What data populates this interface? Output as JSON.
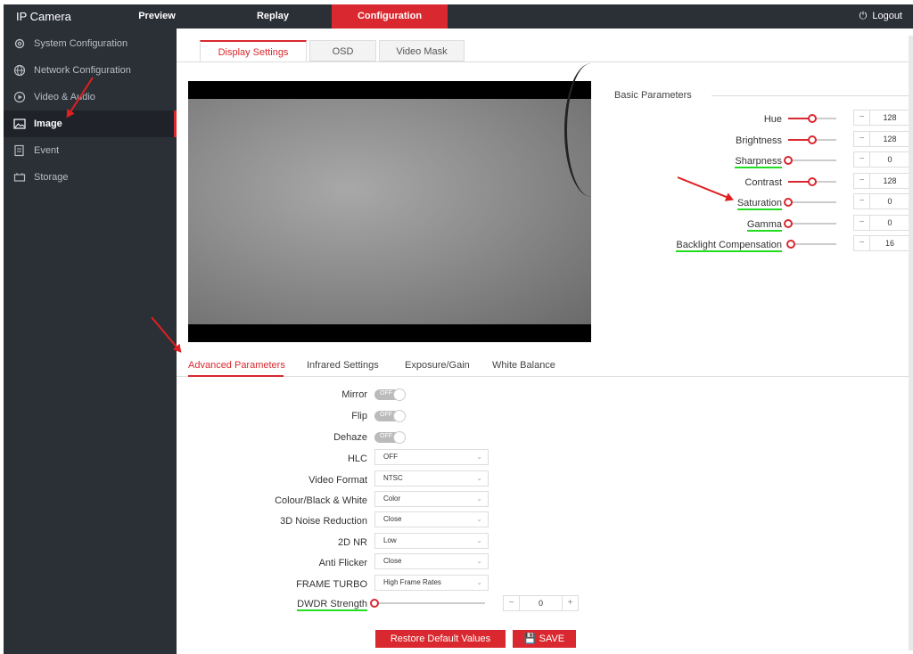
{
  "app": {
    "title": "IP Camera"
  },
  "topnav": [
    {
      "label": "Preview"
    },
    {
      "label": "Replay"
    },
    {
      "label": "Configuration"
    }
  ],
  "logout": {
    "label": "Logout"
  },
  "sidebar": {
    "items": [
      {
        "label": "System Configuration",
        "icon": "gear-icon"
      },
      {
        "label": "Network Configuration",
        "icon": "globe-icon"
      },
      {
        "label": "Video & Audio",
        "icon": "video-icon"
      },
      {
        "label": "Image",
        "icon": "image-icon"
      },
      {
        "label": "Event",
        "icon": "event-icon"
      },
      {
        "label": "Storage",
        "icon": "storage-icon"
      }
    ],
    "active_index": 3
  },
  "tabs": [
    {
      "label": "Display Settings"
    },
    {
      "label": "OSD"
    },
    {
      "label": "Video Mask"
    }
  ],
  "basic": {
    "title": "Basic Parameters",
    "params": [
      {
        "label": "Hue",
        "value": "128",
        "level": 0.5
      },
      {
        "label": "Brightness",
        "value": "128",
        "level": 0.5
      },
      {
        "label": "Sharpness",
        "value": "0",
        "level": 0
      },
      {
        "label": "Contrast",
        "value": "128",
        "level": 0.5
      },
      {
        "label": "Saturation",
        "value": "0",
        "level": 0
      },
      {
        "label": "Gamma",
        "value": "0",
        "level": 0
      },
      {
        "label": "Backlight Compensation",
        "value": "16",
        "level": 0.06
      }
    ]
  },
  "subtabs": [
    {
      "label": "Advanced Parameters"
    },
    {
      "label": "Infrared Settings"
    },
    {
      "label": "Exposure/Gain"
    },
    {
      "label": "White Balance"
    }
  ],
  "advanced": {
    "toggles": [
      {
        "label": "Mirror",
        "state": "OFF"
      },
      {
        "label": "Flip",
        "state": "OFF"
      },
      {
        "label": "Dehaze",
        "state": "OFF"
      }
    ],
    "selects": [
      {
        "label": "HLC",
        "value": "OFF"
      },
      {
        "label": "Video Format",
        "value": "NTSC"
      },
      {
        "label": "Colour/Black & White",
        "value": "Color"
      },
      {
        "label": "3D Noise Reduction",
        "value": "Close"
      },
      {
        "label": "2D NR",
        "value": "Low"
      },
      {
        "label": "Anti Flicker",
        "value": "Close"
      },
      {
        "label": "FRAME TURBO",
        "value": "High Frame Rates"
      }
    ],
    "dwdr": {
      "label": "DWDR Strength",
      "value": "0",
      "level": 0
    }
  },
  "buttons": {
    "restore": "Restore Default Values",
    "save": "SAVE"
  },
  "colors": {
    "accent": "#d9282f",
    "sidebar_bg": "#2b2f36",
    "annotation_green": "#22dd22",
    "annotation_red": "#e02020"
  }
}
